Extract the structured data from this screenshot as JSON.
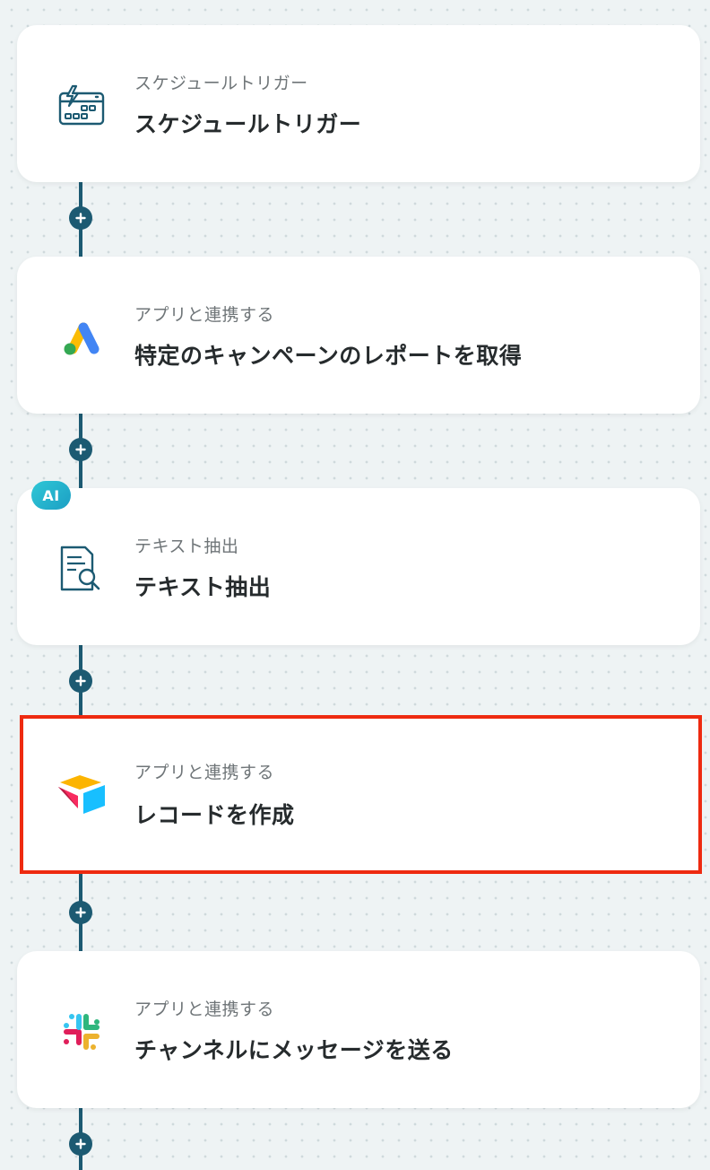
{
  "flow": {
    "steps": [
      {
        "id": "schedule",
        "icon": "calendar-lightning-icon",
        "subtitle": "スケジュールトリガー",
        "title": "スケジュールトリガー"
      },
      {
        "id": "google-ads",
        "icon": "google-ads-icon",
        "subtitle": "アプリと連携する",
        "title": "特定のキャンペーンのレポートを取得"
      },
      {
        "id": "text-extract",
        "icon": "document-search-icon",
        "badge": "AI",
        "subtitle": "テキスト抽出",
        "title": "テキスト抽出"
      },
      {
        "id": "airtable",
        "icon": "airtable-icon",
        "subtitle": "アプリと連携する",
        "title": "レコードを作成",
        "selected": true
      },
      {
        "id": "slack",
        "icon": "slack-icon",
        "subtitle": "アプリと連携する",
        "title": "チャンネルにメッセージを送る"
      }
    ],
    "add_step_icon": "plus-icon"
  },
  "colors": {
    "canvas_background": "#eef3f4",
    "connector": "#1c5a72",
    "selection_outline": "#ee2a10",
    "ai_badge": "#22b5cc",
    "icon_stroke": "#1c5a72"
  }
}
